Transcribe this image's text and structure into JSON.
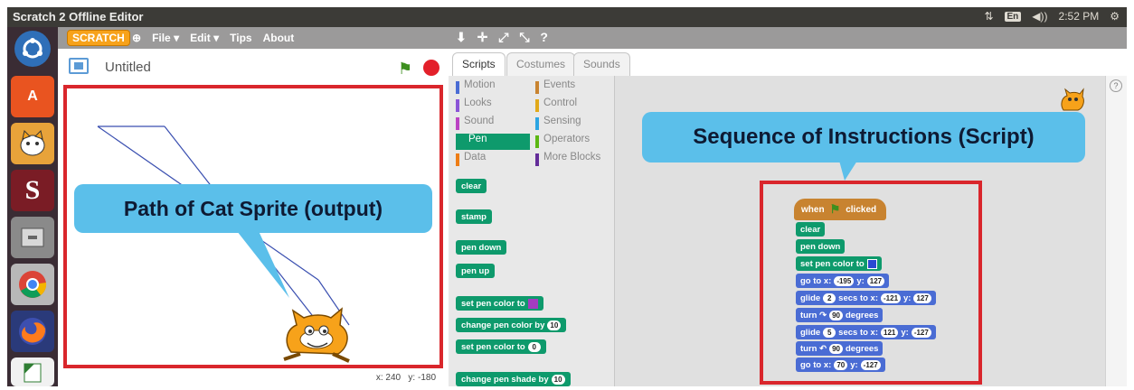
{
  "window": {
    "title": "Scratch 2 Offline Editor"
  },
  "tray": {
    "lang": "En",
    "volume": "◀))",
    "time": "2:52 PM",
    "network": "⇅",
    "settings": "⚙"
  },
  "launcher": {
    "items": [
      "dash",
      "software-center",
      "scratch",
      "app",
      "files",
      "chrome",
      "firefox",
      "document"
    ]
  },
  "menu": {
    "logo": "SCRATCH",
    "items": [
      "File ▾",
      "Edit ▾",
      "Tips",
      "About"
    ],
    "globe": "⊕",
    "tools": "⬇ ✛ ⤢ ⤡ ?"
  },
  "stage": {
    "project_title": "Untitled",
    "flag": "⚑",
    "coords_x_label": "x:",
    "coords_x": "240",
    "coords_y_label": "y:",
    "coords_y": "-180"
  },
  "annotations": {
    "stage_callout": "Path of Cat Sprite (output)",
    "script_callout": "Sequence of Instructions (Script)"
  },
  "tabs": [
    "Scripts",
    "Costumes",
    "Sounds"
  ],
  "categories": [
    {
      "label": "Motion",
      "color": "#4a6cd4"
    },
    {
      "label": "Events",
      "color": "#c88330"
    },
    {
      "label": "Looks",
      "color": "#8a55d7"
    },
    {
      "label": "Control",
      "color": "#e1a91a"
    },
    {
      "label": "Sound",
      "color": "#bb42c3"
    },
    {
      "label": "Sensing",
      "color": "#2ca5e2"
    },
    {
      "label": "Pen",
      "color": "#0e9a6c"
    },
    {
      "label": "Operators",
      "color": "#5cb712"
    },
    {
      "label": "Data",
      "color": "#ee7d16"
    },
    {
      "label": "More Blocks",
      "color": "#632d99"
    }
  ],
  "palette_blocks": {
    "clear": "clear",
    "stamp": "stamp",
    "pen_down": "pen down",
    "pen_up": "pen up",
    "set_color": "set pen color to",
    "change_color": "change pen color by",
    "change_color_val": "10",
    "set_color_num": "set pen color to",
    "set_color_num_val": "0",
    "change_shade": "change pen shade by",
    "change_shade_val": "10"
  },
  "script": {
    "hat_when": "when",
    "hat_flag": "⚑",
    "hat_clicked": "clicked",
    "clear": "clear",
    "pen_down": "pen down",
    "set_color": "set pen color to",
    "goto1": {
      "text": "go to x:",
      "x": "-195",
      "ylabel": "y:",
      "y": "127"
    },
    "glide1": {
      "text": "glide",
      "secs": "2",
      "mid": "secs to x:",
      "x": "-121",
      "ylabel": "y:",
      "y": "127"
    },
    "turn1": {
      "text": "turn ↷",
      "deg": "90",
      "label": "degrees"
    },
    "glide2": {
      "text": "glide",
      "secs": "5",
      "mid": "secs to x:",
      "x": "121",
      "ylabel": "y:",
      "y": "-127"
    },
    "turn2": {
      "text": "turn ↶",
      "deg": "90",
      "label": "degrees"
    },
    "goto2": {
      "text": "go to x:",
      "x": "70",
      "ylabel": "y:",
      "y": "-127"
    }
  }
}
